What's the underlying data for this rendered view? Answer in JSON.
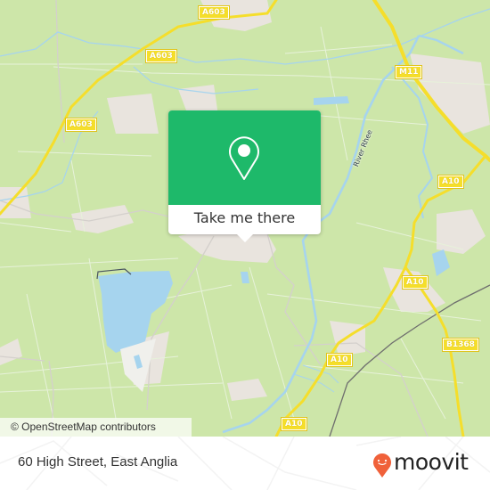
{
  "map": {
    "attribution": "© OpenStreetMap contributors",
    "colors": {
      "land": "#cde6a9",
      "water": "#a6d4ee",
      "road_major": "#f5de2b",
      "urban": "#e8e2dc",
      "popup_green": "#1eb96a",
      "brand_orange": "#f0613a"
    },
    "road_labels": [
      {
        "id": "a603-top",
        "label": "A603"
      },
      {
        "id": "a603-mid",
        "label": "A603"
      },
      {
        "id": "a603-left",
        "label": "A603"
      },
      {
        "id": "m11",
        "label": "M11"
      },
      {
        "id": "a10-upper",
        "label": "A10"
      },
      {
        "id": "a10-right",
        "label": "A10"
      },
      {
        "id": "a10-center",
        "label": "A10"
      },
      {
        "id": "a10-bottom",
        "label": "A10"
      },
      {
        "id": "b1368",
        "label": "B1368"
      }
    ],
    "water_labels": [
      {
        "id": "river-rhee",
        "label": "River Rhee"
      }
    ]
  },
  "popup": {
    "icon": "map-pin-icon",
    "button_label": "Take me there"
  },
  "footer": {
    "address": "60 High Street, East Anglia",
    "brand": "moovit",
    "brand_icon": "moovit-smiley-pin-icon"
  }
}
